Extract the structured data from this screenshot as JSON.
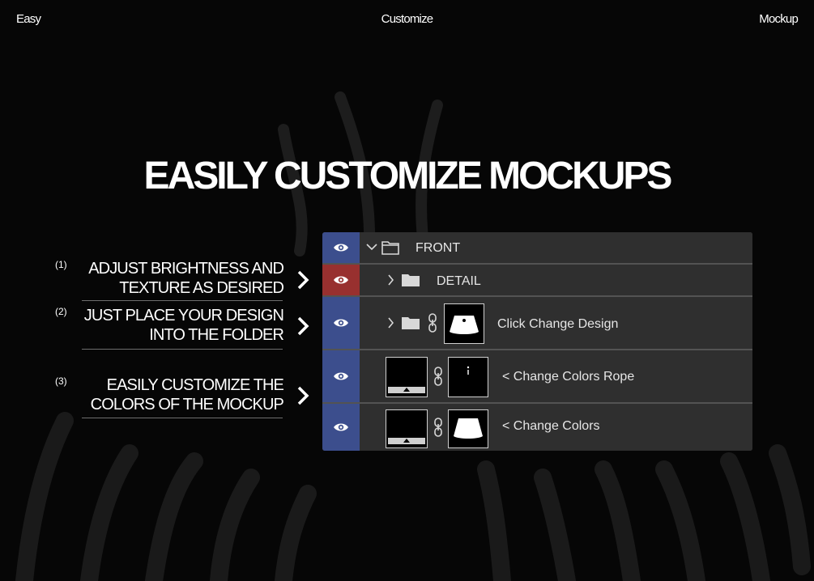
{
  "nav": {
    "left": "Easy",
    "center": "Customize",
    "right": "Mockup"
  },
  "headline": "EASILY CUSTOMIZE MOCKUPS",
  "steps": [
    {
      "number": "(1)",
      "line1": "ADJUST BRIGHTNESS AND",
      "line2": "TEXTURE AS DESIRED"
    },
    {
      "number": "(2)",
      "line1": "JUST PLACE YOUR DESIGN",
      "line2": "INTO THE FOLDER"
    },
    {
      "number": "(3)",
      "line1": "EASILY CUSTOMIZE THE",
      "line2": "COLORS OF THE MOCKUP"
    }
  ],
  "layers": [
    {
      "label": "FRONT",
      "eye_color": "#3c4e8d"
    },
    {
      "label": "DETAIL",
      "eye_color": "#98302f"
    },
    {
      "label": "Click Change Design",
      "eye_color": "#3c4e8d"
    },
    {
      "label": "< Change Colors Rope",
      "eye_color": "#3c4e8d"
    },
    {
      "label": "< Change Colors",
      "eye_color": "#3c4e8d"
    }
  ],
  "colors": {
    "background": "#060606",
    "panel": "#2f2f2f",
    "eye_blue": "#3c4e8d",
    "eye_red": "#98302f"
  }
}
